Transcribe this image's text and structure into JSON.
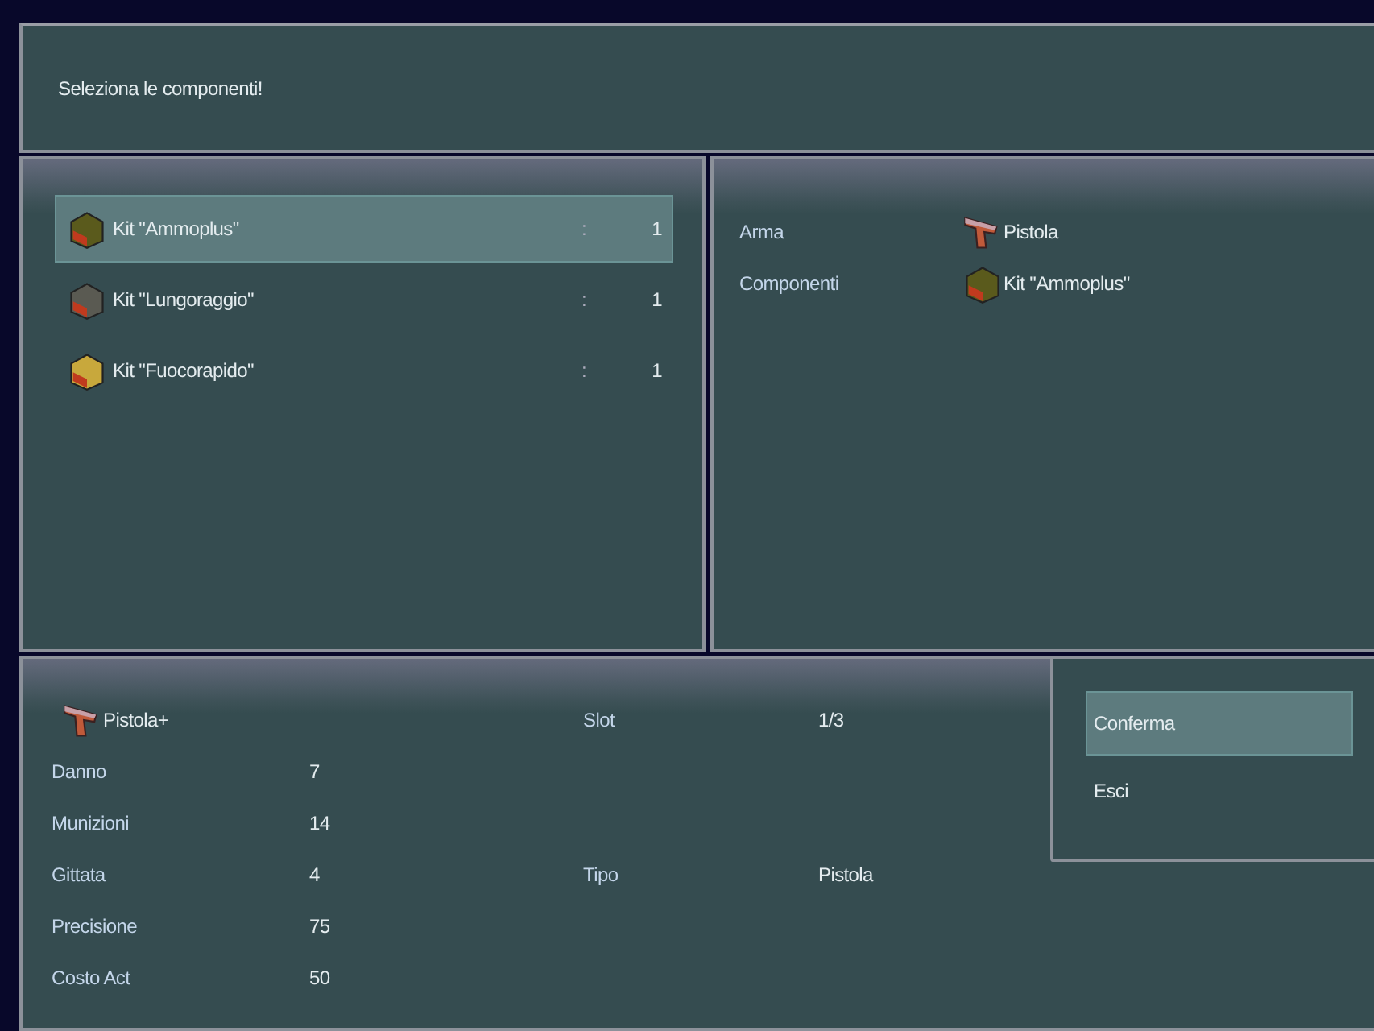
{
  "help": {
    "text": "Seleziona le componenti!"
  },
  "items": [
    {
      "name": "Kit \"Ammoplus\"",
      "separator": ":",
      "count": "1",
      "color": "#5a5a1c",
      "selected": true
    },
    {
      "name": "Kit \"Lungoraggio\"",
      "separator": ":",
      "count": "1",
      "color": "#5a5a52",
      "selected": false
    },
    {
      "name": "Kit \"Fuocorapido\"",
      "separator": ":",
      "count": "1",
      "color": "#c8a83c",
      "selected": false
    }
  ],
  "recipe": [
    {
      "label": "Arma",
      "value": "Pistola",
      "kind": "pistol"
    },
    {
      "label": "Componenti",
      "value": "Kit \"Ammoplus\"",
      "kind": "chest",
      "color": "#5a5a1c"
    }
  ],
  "result": {
    "rows": [
      {
        "kind": "name",
        "name": "Pistola+",
        "side_label": "Slot",
        "side_value": "1/3"
      },
      {
        "kind": "stat",
        "label": "Danno",
        "value": "7"
      },
      {
        "kind": "stat",
        "label": "Munizioni",
        "value": "14"
      },
      {
        "kind": "stat",
        "label": "Gittata",
        "value": "4",
        "side_label": "Tipo",
        "side_value": "Pistola"
      },
      {
        "kind": "stat",
        "label": "Precisione",
        "value": "75"
      },
      {
        "kind": "stat",
        "label": "Costo Act",
        "value": "50"
      }
    ]
  },
  "commands": [
    {
      "label": "Conferma",
      "selected": true
    },
    {
      "label": "Esci",
      "selected": false
    }
  ]
}
